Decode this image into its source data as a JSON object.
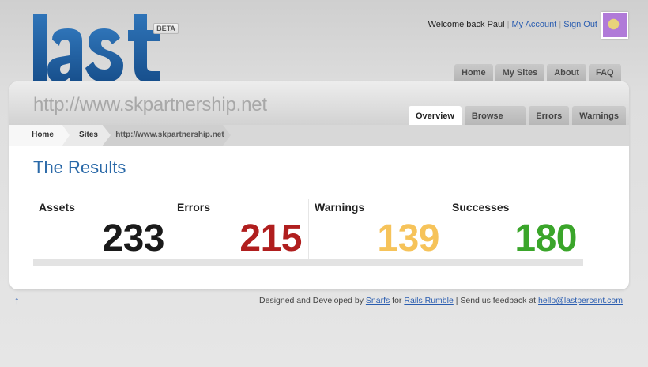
{
  "brand": {
    "logo_text": "last",
    "badge": "BETA",
    "brand_color": "#1f5c9e"
  },
  "user": {
    "welcome": "Welcome back Paul",
    "my_account": "My Account",
    "sign_out": "Sign Out"
  },
  "top_nav": [
    "Home",
    "My Sites",
    "About",
    "FAQ"
  ],
  "site": {
    "url_title": "http://www.skpartnership.net"
  },
  "sub_tabs": [
    {
      "label": "Overview",
      "active": true
    },
    {
      "label": "Browse Assets",
      "active": false
    },
    {
      "label": "Errors",
      "active": false
    },
    {
      "label": "Warnings",
      "active": false
    }
  ],
  "breadcrumb": [
    "Home",
    "Sites",
    "http://www.skpartnership.net"
  ],
  "results": {
    "title": "The Results",
    "stats": [
      {
        "label": "Assets",
        "value": "233",
        "color": "#1a1a1a"
      },
      {
        "label": "Errors",
        "value": "215",
        "color": "#b01e1e"
      },
      {
        "label": "Warnings",
        "value": "139",
        "color": "#f6c35a"
      },
      {
        "label": "Successes",
        "value": "180",
        "color": "#3aa52a"
      }
    ]
  },
  "footer": {
    "up_arrow": "↑",
    "text1": "Designed and Developed by",
    "snarfs": "Snarfs",
    "text2": "for",
    "rails_rumble": "Rails Rumble",
    "text3": "| Send us feedback at",
    "email": "hello@lastpercent.com"
  }
}
